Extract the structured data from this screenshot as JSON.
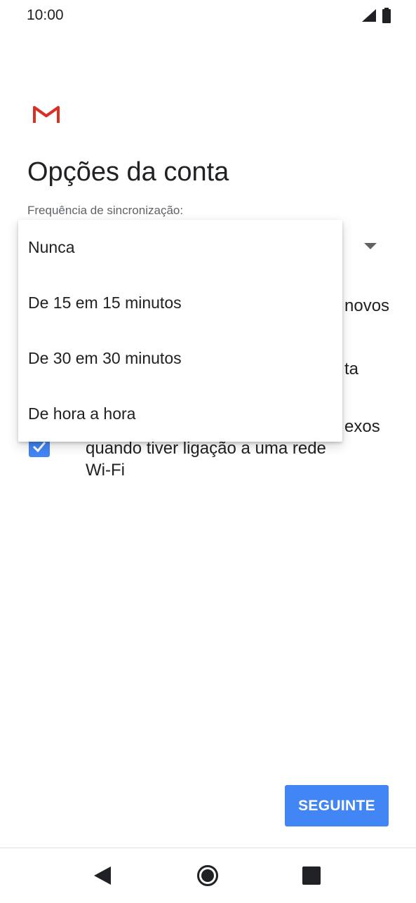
{
  "status_bar": {
    "time": "10:00",
    "icons": [
      "signal-icon",
      "battery-icon"
    ]
  },
  "app": {
    "logo": "gmail-logo",
    "title": "Opções da conta"
  },
  "sync": {
    "label": "Frequência de sincronização:",
    "dropdown_icon": "dropdown-arrow-icon",
    "menu": [
      "Nunca",
      "De 15 em 15 minutos",
      "De 30 em 30 minutos",
      "De hora a hora"
    ]
  },
  "options": {
    "option1_visible_suffix": "novos",
    "option2_visible_suffix": "ta",
    "option3_visible_suffix": "exos",
    "option3_line2": "quando tiver ligação a uma rede",
    "option3_line3": "Wi-Fi",
    "option3_checked": true
  },
  "actions": {
    "next_label": "SEGUINTE"
  },
  "colors": {
    "accent": "#4285f4",
    "text_primary": "#202124",
    "text_secondary": "#5f6368",
    "gmail_red": "#d93025"
  }
}
